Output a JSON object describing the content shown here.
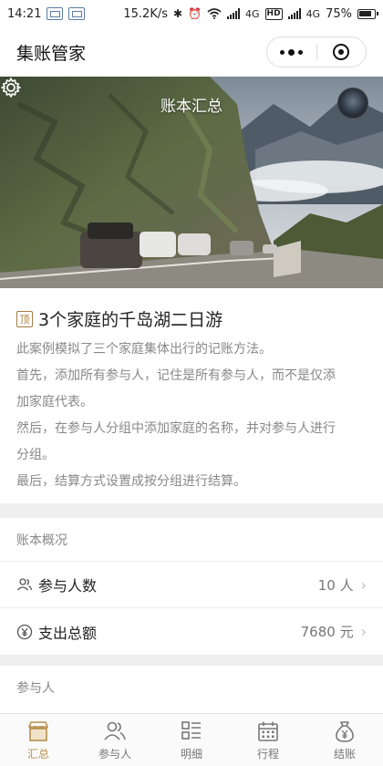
{
  "status_bar": {
    "time": "14:21",
    "speed": "15.2K/s",
    "network_1": "4G",
    "hd": "HD",
    "network_2": "4G",
    "battery": "75%"
  },
  "nav": {
    "title": "集账管家"
  },
  "hero": {
    "title": "账本汇总"
  },
  "info": {
    "badge": "顶",
    "title": "3个家庭的千岛湖二日游",
    "lines": [
      "此案例模拟了三个家庭集体出行的记账方法。",
      "首先，添加所有参与人，记住是所有参与人，而不是仅添",
      "加家庭代表。",
      "然后，在参与人分组中添加家庭的名称，并对参与人进行",
      "分组。",
      "最后，结算方式设置成按分组进行结算。"
    ]
  },
  "overview": {
    "heading": "账本概况",
    "rows": [
      {
        "label": "参与人数",
        "value": "10 人",
        "icon": "people-icon"
      },
      {
        "label": "支出总额",
        "value": "7680 元",
        "icon": "yuan-icon"
      }
    ]
  },
  "participants": {
    "heading": "参与人"
  },
  "tabs": [
    {
      "label": "汇总",
      "icon": "store-icon",
      "active": true
    },
    {
      "label": "参与人",
      "icon": "people-icon",
      "active": false
    },
    {
      "label": "明细",
      "icon": "list-icon",
      "active": false
    },
    {
      "label": "行程",
      "icon": "calendar-icon",
      "active": false
    },
    {
      "label": "结账",
      "icon": "money-bag-icon",
      "active": false
    }
  ],
  "colors": {
    "accent": "#b8904d",
    "badge": "#a47a3f"
  }
}
